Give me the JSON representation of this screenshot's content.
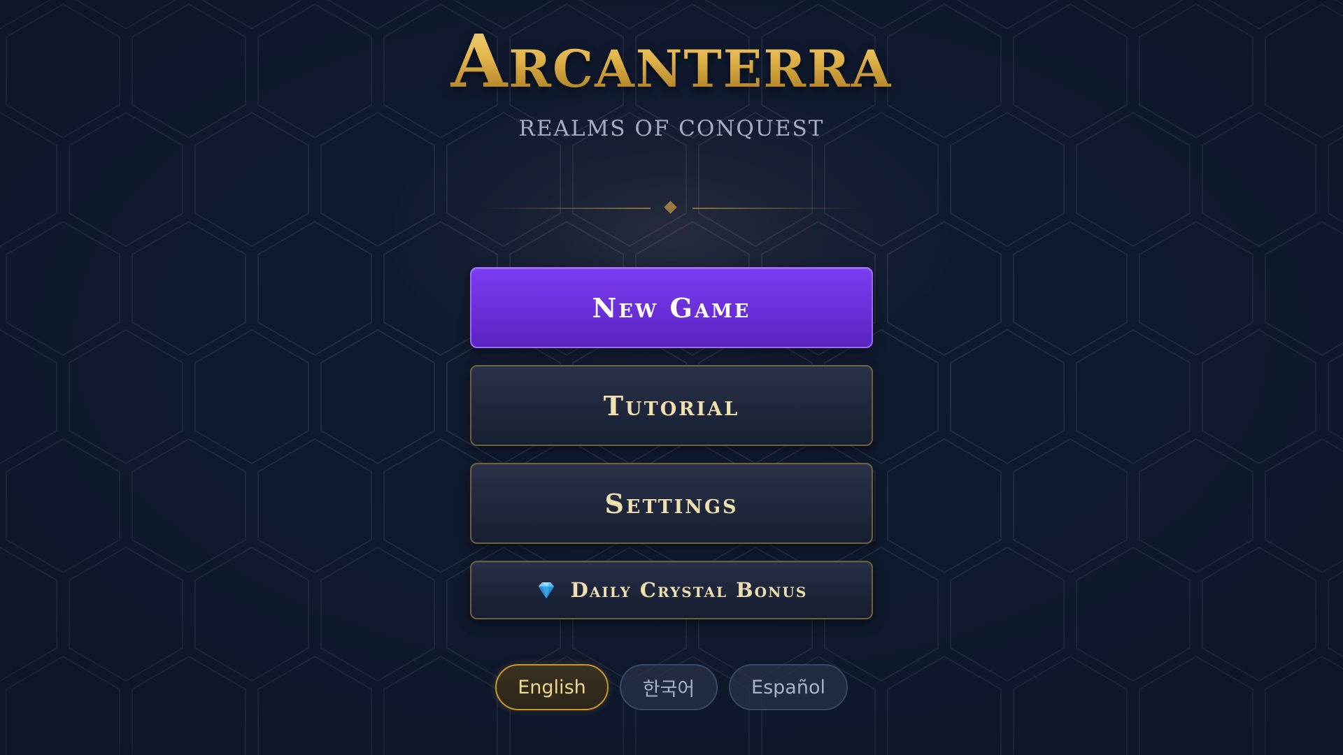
{
  "title": "Arcanterra",
  "subtitle": "REALMS OF CONQUEST",
  "menu": {
    "new_game": "New Game",
    "tutorial": "Tutorial",
    "settings": "Settings",
    "daily_bonus": "Daily Crystal Bonus",
    "daily_bonus_icon": "gem-icon"
  },
  "languages": {
    "selected": "English",
    "options": [
      "English",
      "한국어",
      "Español"
    ]
  },
  "colors": {
    "background": "#101a2e",
    "gold_accent": "#e0b856",
    "primary_button": "#6a2fd9",
    "secondary_button": "#1e263b",
    "button_border_gold": "#6f5f3f",
    "hex_pattern": "#2f3a4c"
  }
}
